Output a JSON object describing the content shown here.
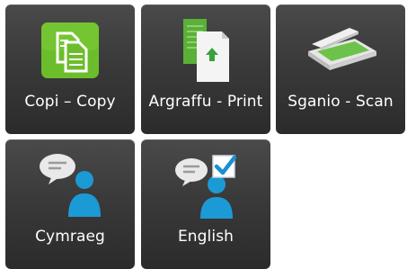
{
  "tiles": [
    {
      "label": "Copi – Copy",
      "icon": "copy-icon"
    },
    {
      "label": "Argraffu - Print",
      "icon": "print-icon"
    },
    {
      "label": "Sganio - Scan",
      "icon": "scanner-icon"
    },
    {
      "label": "Cymraeg",
      "icon": "welsh-language-user-icon"
    },
    {
      "label": "English",
      "icon": "english-language-user-icon"
    }
  ],
  "colors": {
    "tile_bg": "#3a3a3a",
    "copy_green": "#6cbd2b",
    "doc_green": "#5bb03a",
    "user_blue": "#1c9ad6",
    "check_blue": "#1b8fd0"
  }
}
